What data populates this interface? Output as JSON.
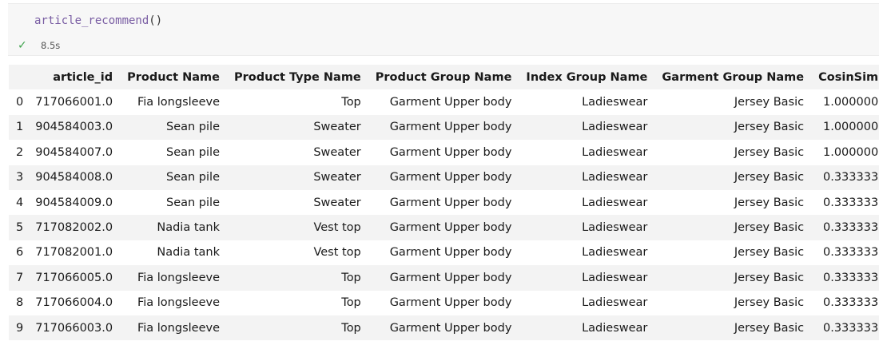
{
  "cell": {
    "code": "article_recommend",
    "code_parens": "()",
    "status_icon": "check-icon",
    "exec_time": "8.5s"
  },
  "table": {
    "columns": [
      "",
      "article_id",
      "Product Name",
      "Product Type Name",
      "Product Group Name",
      "Index Group Name",
      "Garment Group Name",
      "CosinSim"
    ],
    "rows": [
      [
        "0",
        "717066001.0",
        "Fia longsleeve",
        "Top",
        "Garment Upper body",
        "Ladieswear",
        "Jersey Basic",
        "1.000000"
      ],
      [
        "1",
        "904584003.0",
        "Sean pile",
        "Sweater",
        "Garment Upper body",
        "Ladieswear",
        "Jersey Basic",
        "1.000000"
      ],
      [
        "2",
        "904584007.0",
        "Sean pile",
        "Sweater",
        "Garment Upper body",
        "Ladieswear",
        "Jersey Basic",
        "1.000000"
      ],
      [
        "3",
        "904584008.0",
        "Sean pile",
        "Sweater",
        "Garment Upper body",
        "Ladieswear",
        "Jersey Basic",
        "0.333333"
      ],
      [
        "4",
        "904584009.0",
        "Sean pile",
        "Sweater",
        "Garment Upper body",
        "Ladieswear",
        "Jersey Basic",
        "0.333333"
      ],
      [
        "5",
        "717082002.0",
        "Nadia tank",
        "Vest top",
        "Garment Upper body",
        "Ladieswear",
        "Jersey Basic",
        "0.333333"
      ],
      [
        "6",
        "717082001.0",
        "Nadia tank",
        "Vest top",
        "Garment Upper body",
        "Ladieswear",
        "Jersey Basic",
        "0.333333"
      ],
      [
        "7",
        "717066005.0",
        "Fia longsleeve",
        "Top",
        "Garment Upper body",
        "Ladieswear",
        "Jersey Basic",
        "0.333333"
      ],
      [
        "8",
        "717066004.0",
        "Fia longsleeve",
        "Top",
        "Garment Upper body",
        "Ladieswear",
        "Jersey Basic",
        "0.333333"
      ],
      [
        "9",
        "717066003.0",
        "Fia longsleeve",
        "Top",
        "Garment Upper body",
        "Ladieswear",
        "Jersey Basic",
        "0.333333"
      ]
    ]
  }
}
